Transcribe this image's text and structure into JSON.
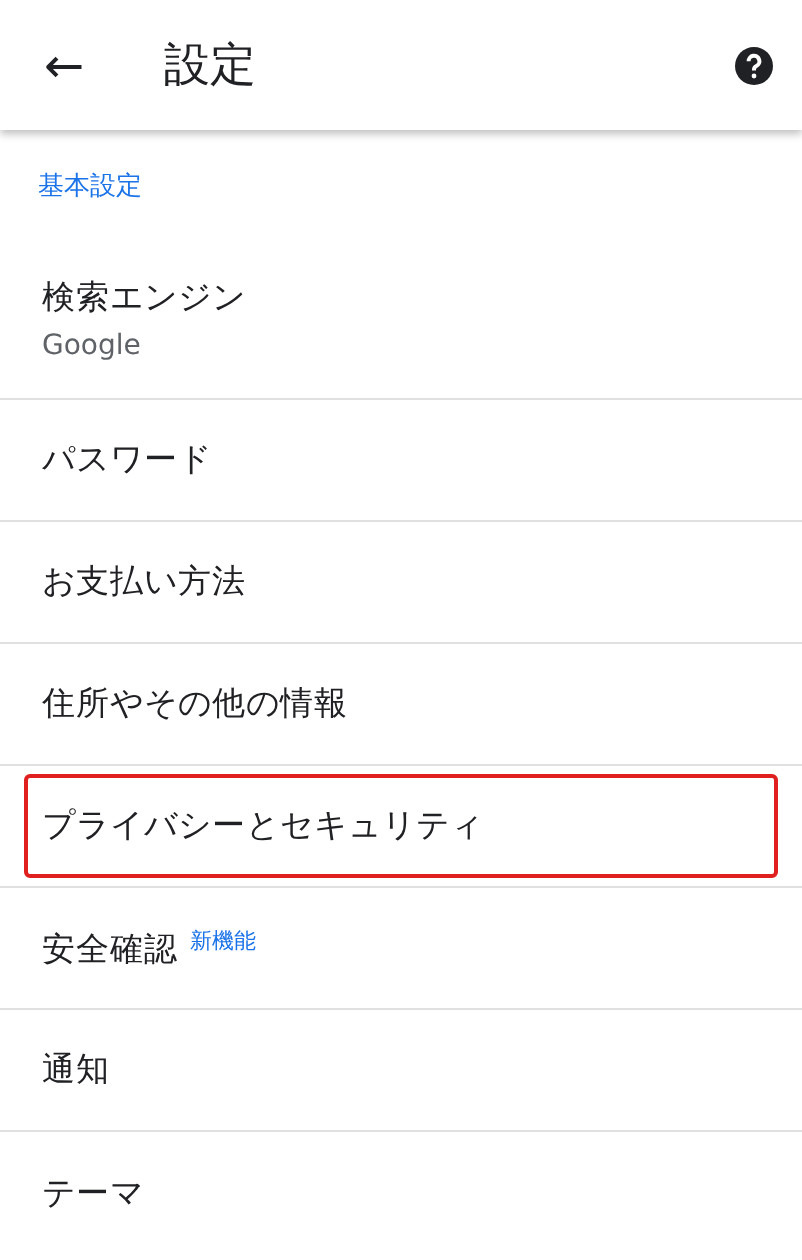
{
  "app_bar": {
    "back": "←",
    "title": "設定"
  },
  "section": {
    "title": "基本設定"
  },
  "items": [
    {
      "label": "検索エンジン",
      "subtitle": "Google",
      "highlighted": false
    },
    {
      "label": "パスワード",
      "highlighted": false
    },
    {
      "label": "お支払い方法",
      "highlighted": false
    },
    {
      "label": "住所やその他の情報",
      "highlighted": false
    },
    {
      "label": "プライバシーとセキュリティ",
      "highlighted": true
    },
    {
      "label": "安全確認",
      "badge": "新機能",
      "highlighted": false
    },
    {
      "label": "通知",
      "highlighted": false
    },
    {
      "label": "テーマ",
      "highlighted": false
    }
  ]
}
